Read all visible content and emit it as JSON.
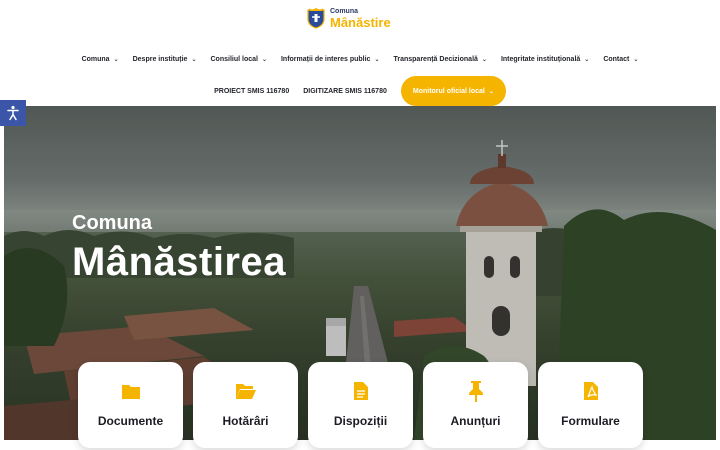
{
  "logo": {
    "small": "Comuna",
    "big": "Mânăstire"
  },
  "nav": {
    "row1": [
      {
        "label": "Comuna"
      },
      {
        "label": "Despre instituție"
      },
      {
        "label": "Consiliul local"
      },
      {
        "label": "Informații de interes public"
      },
      {
        "label": "Transparență Decizională"
      },
      {
        "label": "Integritate instituțională"
      },
      {
        "label": "Contact"
      }
    ],
    "row2": [
      {
        "label": "PROIECT SMIS 116780"
      },
      {
        "label": "DIGITIZARE SMIS 116780"
      }
    ],
    "cta": "Monitorul oficial local"
  },
  "hero": {
    "subtitle": "Comuna",
    "title": "Mânăstirea"
  },
  "cards": [
    {
      "label": "Documente",
      "icon": "folder-icon"
    },
    {
      "label": "Hotărâri",
      "icon": "folder-open-icon"
    },
    {
      "label": "Dispoziții",
      "icon": "document-icon"
    },
    {
      "label": "Anunțuri",
      "icon": "pin-icon"
    },
    {
      "label": "Formulare",
      "icon": "pdf-icon"
    }
  ],
  "colors": {
    "accent": "#f5b400",
    "accessibility": "#3b55a8",
    "text": "#23252c"
  }
}
